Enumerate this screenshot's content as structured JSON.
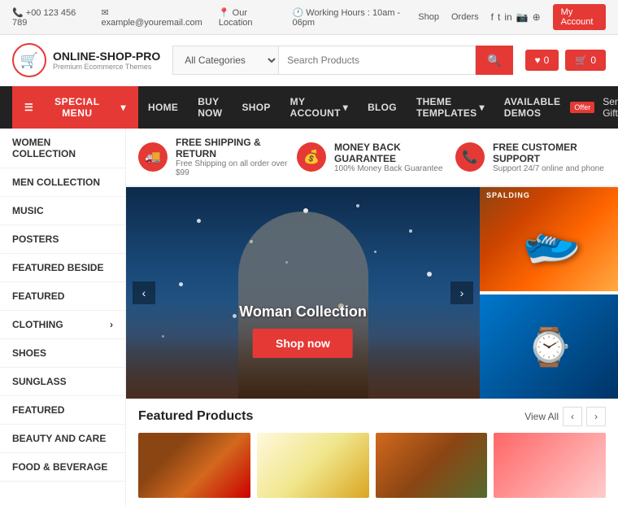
{
  "topbar": {
    "phone": "+00 123 456 789",
    "email": "example@youremail.com",
    "location": "Our Location",
    "hours": "Working Hours : 10am - 06pm",
    "shop_link": "Shop",
    "orders_link": "Orders",
    "my_account": "My Account"
  },
  "header": {
    "logo_main": "ONLINE-SHOP-PRO",
    "logo_sub": "Premium Ecommerce Themes",
    "category_default": "All Categories",
    "search_placeholder": "Search Products",
    "wishlist_count": "0",
    "cart_count": "0"
  },
  "nav": {
    "special_menu": "SPECIAL MENU",
    "links": [
      {
        "label": "HOME",
        "has_dropdown": false
      },
      {
        "label": "BUY NOW",
        "has_dropdown": false
      },
      {
        "label": "SHOP",
        "has_dropdown": false
      },
      {
        "label": "MY ACCOUNT",
        "has_dropdown": true
      },
      {
        "label": "BLOG",
        "has_dropdown": false
      },
      {
        "label": "THEME TEMPLATES",
        "has_dropdown": true
      },
      {
        "label": "AVAILABLE DEMOS",
        "has_dropdown": false
      }
    ],
    "offer_badge": "Offer",
    "send_gift": "Send Gift"
  },
  "sidebar": {
    "items": [
      {
        "label": "WOMEN COLLECTION",
        "has_arrow": false
      },
      {
        "label": "MEN COLLECTION",
        "has_arrow": false
      },
      {
        "label": "MUSIC",
        "has_arrow": false
      },
      {
        "label": "POSTERS",
        "has_arrow": false
      },
      {
        "label": "FEATURED BESIDE",
        "has_arrow": false
      },
      {
        "label": "FEATURED",
        "has_arrow": false
      },
      {
        "label": "CLOTHING",
        "has_arrow": true
      },
      {
        "label": "SHOES",
        "has_arrow": false
      },
      {
        "label": "SUNGLASS",
        "has_arrow": false
      },
      {
        "label": "FEATURED",
        "has_arrow": false
      },
      {
        "label": "BEAUTY AND CARE",
        "has_arrow": false
      },
      {
        "label": "FOOD & BEVERAGE",
        "has_arrow": false
      }
    ]
  },
  "features": [
    {
      "icon": "🚚",
      "title": "FREE SHIPPING & RETURN",
      "desc": "Free Shipping on all order over $99"
    },
    {
      "icon": "💰",
      "title": "MONEY BACK GUARANTEE",
      "desc": "100% Money Back Guarantee"
    },
    {
      "icon": "📞",
      "title": "FREE CUSTOMER SUPPORT",
      "desc": "Support 24/7 online and phone"
    }
  ],
  "hero": {
    "collection_title": "Woman Collection",
    "shop_now": "Shop now"
  },
  "featured": {
    "title": "Featured Products",
    "view_all": "View All"
  }
}
